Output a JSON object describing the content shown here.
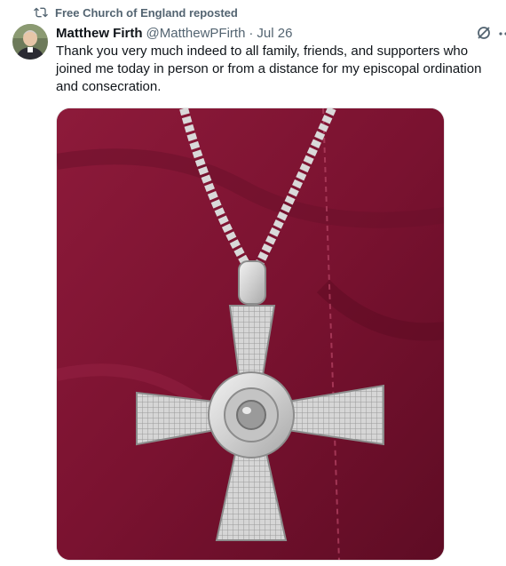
{
  "repost": {
    "label": "Free Church of England reposted",
    "icon": "repost-icon"
  },
  "tweet": {
    "author_name": "Matthew Firth",
    "handle": "@MatthewPFirth",
    "separator": "·",
    "date": "Jul 26",
    "text": "Thank you very much indeed to all family, friends, and supporters who joined me today in person or from a distance for my episcopal ordination and consecration.",
    "grok_icon": "grok-icon",
    "more_icon": "more-icon"
  },
  "colors": {
    "secondary_text": "#536471",
    "primary_text": "#0f1419",
    "shirt": "#7c1430",
    "silver": "#d8d8d8"
  }
}
